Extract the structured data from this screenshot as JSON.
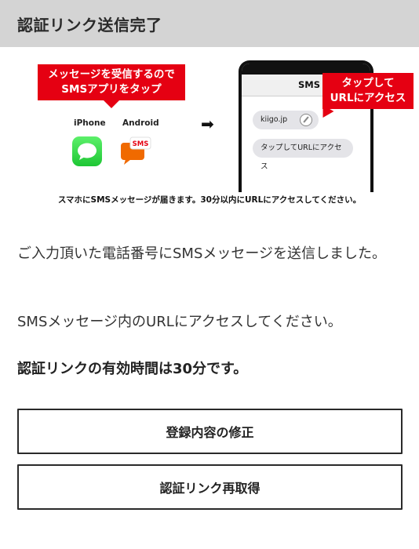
{
  "header": {
    "title": "認証リンク送信完了"
  },
  "illustration": {
    "callout_left_line1": "メッセージを受信するので",
    "callout_left_line2": "SMSアプリをタップ",
    "iphone_label": "iPhone",
    "android_label": "Android",
    "android_badge": "SMS",
    "arrow_icon": "arrow-right-icon",
    "phone_title": "SMS",
    "bubble_url": "kiigo.jp",
    "bubble_tap": "タップしてURLにアクセス",
    "callout_right_line1": "タップして",
    "callout_right_line2": "URLにアクセス",
    "caption": "スマホにSMSメッセージが届きます。30分以内にURLにアクセスしてください。",
    "accent_color": "#e50012"
  },
  "body": {
    "paragraph1": "ご入力頂いた電話番号にSMSメッセージを送信しました。",
    "paragraph2": "SMSメッセージ内のURLにアクセスしてください。",
    "paragraph3": "認証リンクの有効時間は30分です。"
  },
  "buttons": {
    "edit_label": "登録内容の修正",
    "resend_label": "認証リンク再取得"
  }
}
